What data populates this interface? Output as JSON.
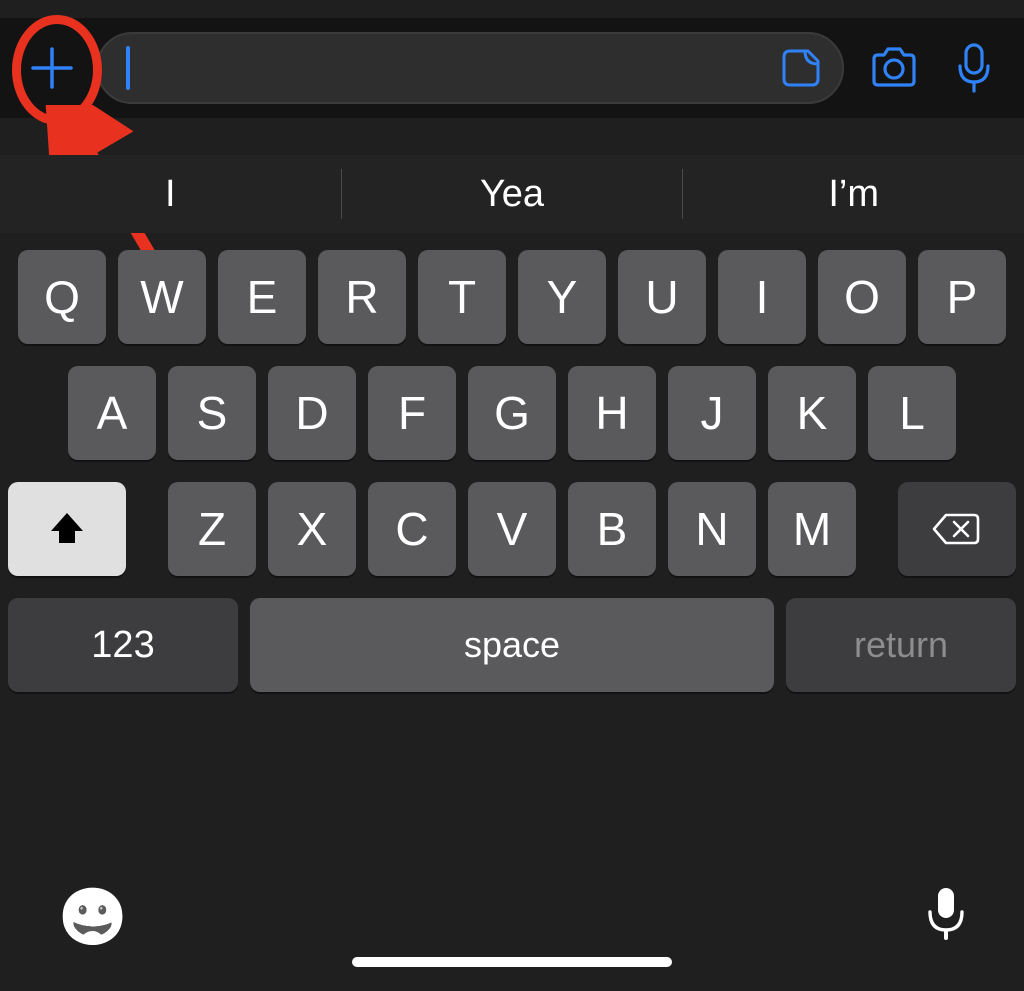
{
  "chatBar": {
    "inputValue": "",
    "placeholder": ""
  },
  "suggestions": [
    "I",
    "Yea",
    "I’m"
  ],
  "keyboard": {
    "row1": [
      "Q",
      "W",
      "E",
      "R",
      "T",
      "Y",
      "U",
      "I",
      "O",
      "P"
    ],
    "row2": [
      "A",
      "S",
      "D",
      "F",
      "G",
      "H",
      "J",
      "K",
      "L"
    ],
    "row3": [
      "Z",
      "X",
      "C",
      "V",
      "B",
      "N",
      "M"
    ],
    "numKey": "123",
    "spaceKey": "space",
    "returnKey": "return"
  },
  "icons": {
    "plus": "plus-icon",
    "sticker": "sticker-icon",
    "camera": "camera-icon",
    "micChat": "microphone-icon",
    "shift": "shift-icon",
    "backspace": "backspace-icon",
    "emoji": "emoji-icon",
    "micDictate": "microphone-icon"
  },
  "annotation": {
    "target": "attach-plus-button"
  },
  "colors": {
    "accent": "#2f82f7",
    "annotation": "#e8321f"
  }
}
